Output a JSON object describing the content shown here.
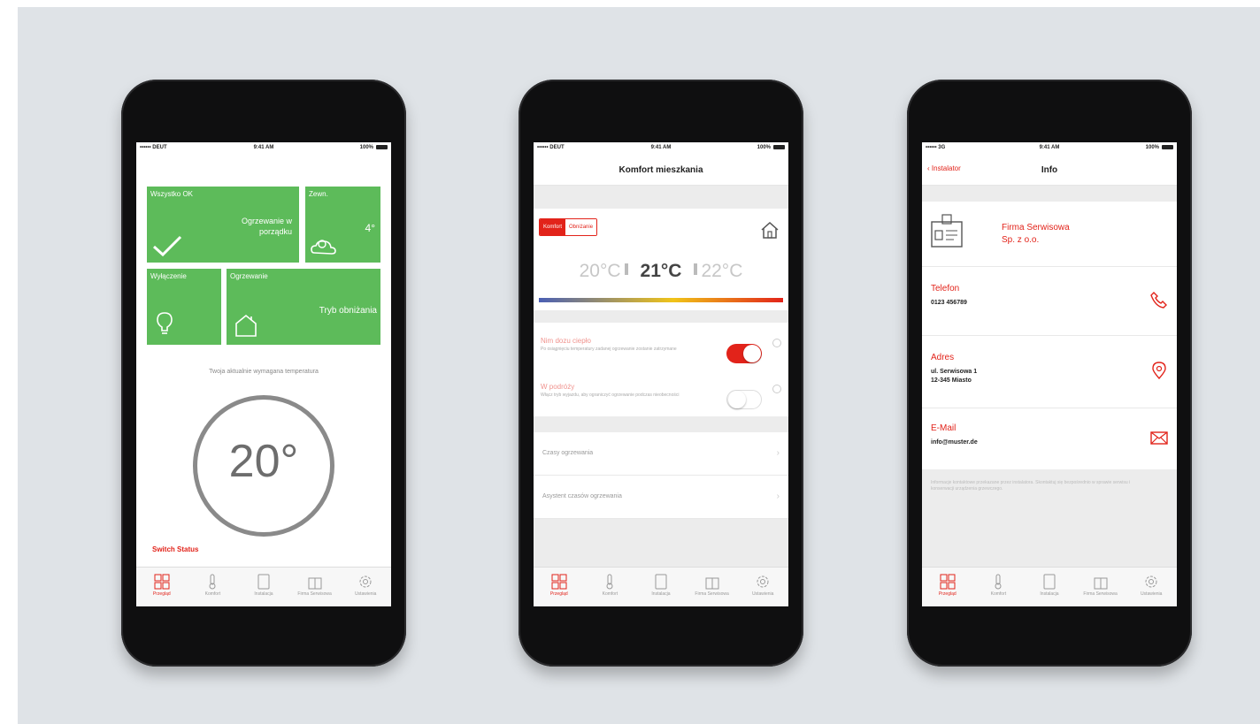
{
  "phone1": {
    "status": {
      "carrier": "•••••• DEUT",
      "time": "9:41 AM",
      "battery": "100%"
    },
    "tiles": {
      "all_ok_label": "Wszystko OK",
      "all_ok_status": "Ogrzewanie w porządku",
      "outside_label": "Zewn.",
      "outside_temp": "4°",
      "lighting_label": "Wyłączenie",
      "heating_label": "Ogrzewanie",
      "heating_mode": "Tryb obniżania"
    },
    "required_temp_label": "Twoja aktualnie wymagana temperatura",
    "dial_value": "20°",
    "switch_status": "Switch Status"
  },
  "phone2": {
    "status": {
      "carrier": "•••••• DEUT",
      "time": "9:41 AM",
      "battery": "100%"
    },
    "title": "Komfort mieszkania",
    "segment": {
      "on": "Komfort",
      "off": "Obniżanie"
    },
    "temps": {
      "low": "20°C",
      "current": "21°C",
      "high": "22°C"
    },
    "option1": {
      "title": "Nim dozu ciepło",
      "desc": "Po osiągnięciu temperatury zadanej ogrzewanie zostanie zatrzymane"
    },
    "option2": {
      "title": "W podróży",
      "desc": "Włącz tryb wyjazdu, aby ograniczyć ogrzewanie podczas nieobecności"
    },
    "rows": [
      "Czasy ogrzewania",
      "Asystent czasów ogrzewania"
    ]
  },
  "phone3": {
    "status": {
      "carrier": "•••••• 3G",
      "time": "9:41 AM",
      "battery": "100%"
    },
    "back_label": "Instalator",
    "title": "Info",
    "company_line1": "Firma Serwisowa",
    "company_line2": "Sp. z o.o.",
    "phone_label": "Telefon",
    "phone_value": "0123 456789",
    "address_label": "Adres",
    "address_line1": "ul. Serwisowa 1",
    "address_line2": "12-345 Miasto",
    "email_label": "E-Mail",
    "email_value": "info@muster.de",
    "footnote": "Informacje kontaktowe przekazane przez instalatora. Skontaktuj się bezpośrednio w sprawie serwisu i konserwacji urządzenia grzewczego."
  },
  "tabs": [
    "Przegląd",
    "Komfort",
    "Instalacja",
    "Firma Serwisowa",
    "Ustawienia"
  ],
  "colors": {
    "accent": "#e2231a",
    "tile_green": "#5dbb5a",
    "background": "#dfe3e7"
  },
  "icons": [
    "check-icon",
    "weather-icon",
    "bulb-icon",
    "house-icon",
    "phone-icon",
    "location-icon",
    "mail-icon",
    "id-card-icon",
    "grid-icon",
    "thermometer-icon",
    "tablet-icon",
    "building-icon",
    "gear-icon"
  ]
}
